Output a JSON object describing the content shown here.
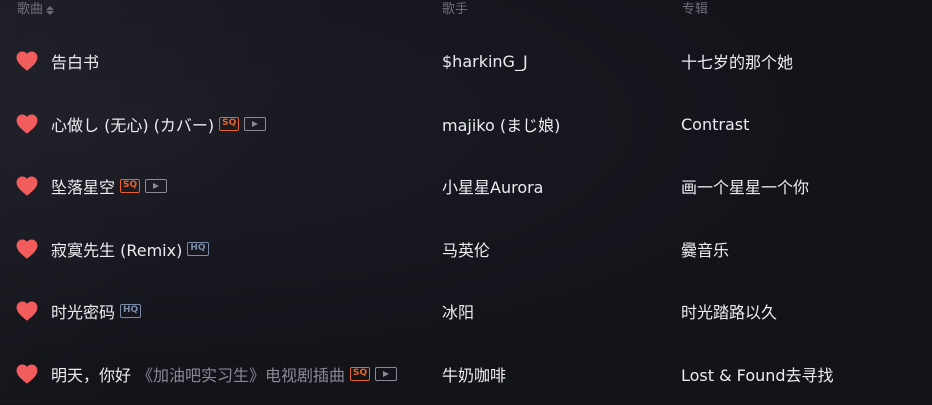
{
  "header": {
    "title_col": "歌曲",
    "artist_col": "歌手",
    "album_col": "专辑"
  },
  "colors": {
    "heart": "#f25c5c",
    "sq_badge": "#e8622a",
    "hq_badge": "#7a8ca8",
    "background": "#13131a"
  },
  "songs": [
    {
      "title": "告白书",
      "subtitle": "",
      "artist": "$harkinG_J",
      "album": "十七岁的那个她",
      "sq": false,
      "hq": false,
      "mv": false,
      "liked": true
    },
    {
      "title": "心做し (无心) (カバー)",
      "subtitle": "",
      "artist": "majiko (まじ娘)",
      "album": "Contrast",
      "sq": true,
      "hq": false,
      "mv": true,
      "liked": true
    },
    {
      "title": "坠落星空",
      "subtitle": "",
      "artist": "小星星Aurora",
      "album": "画一个星星一个你",
      "sq": true,
      "hq": false,
      "mv": true,
      "liked": true
    },
    {
      "title": "寂寞先生 (Remix)",
      "subtitle": "",
      "artist": "马英伦",
      "album": "爨音乐",
      "sq": false,
      "hq": true,
      "mv": false,
      "liked": true
    },
    {
      "title": "时光密码",
      "subtitle": "",
      "artist": "冰阳",
      "album": "时光踏路以久",
      "sq": false,
      "hq": true,
      "mv": false,
      "liked": true
    },
    {
      "title": "明天，你好",
      "subtitle": "《加油吧实习生》电视剧插曲",
      "artist": "牛奶咖啡",
      "album": "Lost & Found去寻找",
      "sq": true,
      "hq": false,
      "mv": true,
      "liked": true
    }
  ],
  "badge_labels": {
    "sq": "SQ",
    "hq": "HQ"
  }
}
